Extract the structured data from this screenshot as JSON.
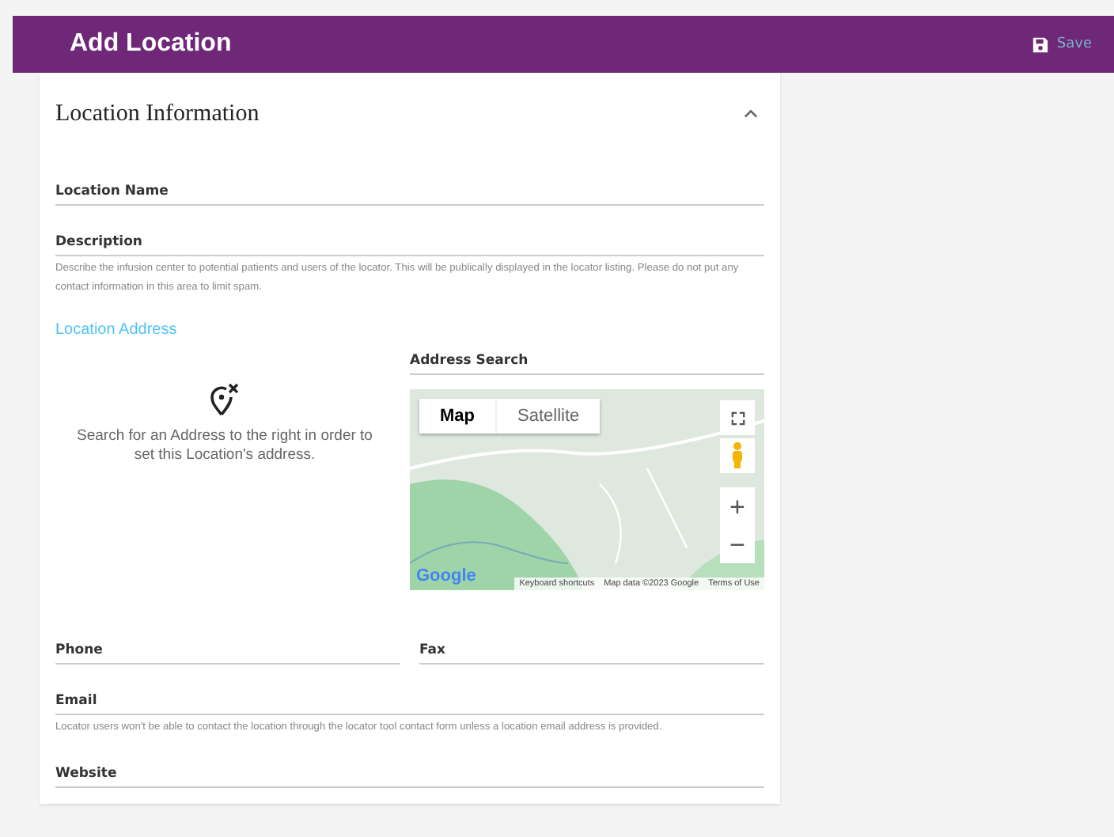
{
  "header": {
    "title": "Add Location",
    "save_label": "Save"
  },
  "section": {
    "title": "Location Information",
    "expanded": true
  },
  "fields_top": [
    {
      "label": "Location Name"
    },
    {
      "label": "Description",
      "helper": "Describe the infusion center to potential patients and users of the locator. This will be publically displayed in the locator listing. Please do not put any contact information in this area to limit spam."
    }
  ],
  "address": {
    "heading": "Location Address",
    "empty_message": "Search for an Address to the right in order to set this Location's address.",
    "search_label": "Address Search",
    "map": {
      "view_buttons": [
        {
          "label": "Map",
          "selected": true
        },
        {
          "label": "Satellite",
          "selected": false
        }
      ],
      "zoom_in": "+",
      "zoom_out": "−",
      "logo": "Google",
      "footer": [
        "Keyboard shortcuts",
        "Map data ©2023 Google",
        "Terms of Use"
      ]
    }
  },
  "contact_row": [
    {
      "label": "Phone"
    },
    {
      "label": "Fax"
    }
  ],
  "fields_bottom": [
    {
      "label": "Email",
      "helper": "Locator users won't be able to contact the location through the locator tool contact form unless a location email address is provided."
    },
    {
      "label": "Website"
    }
  ]
}
